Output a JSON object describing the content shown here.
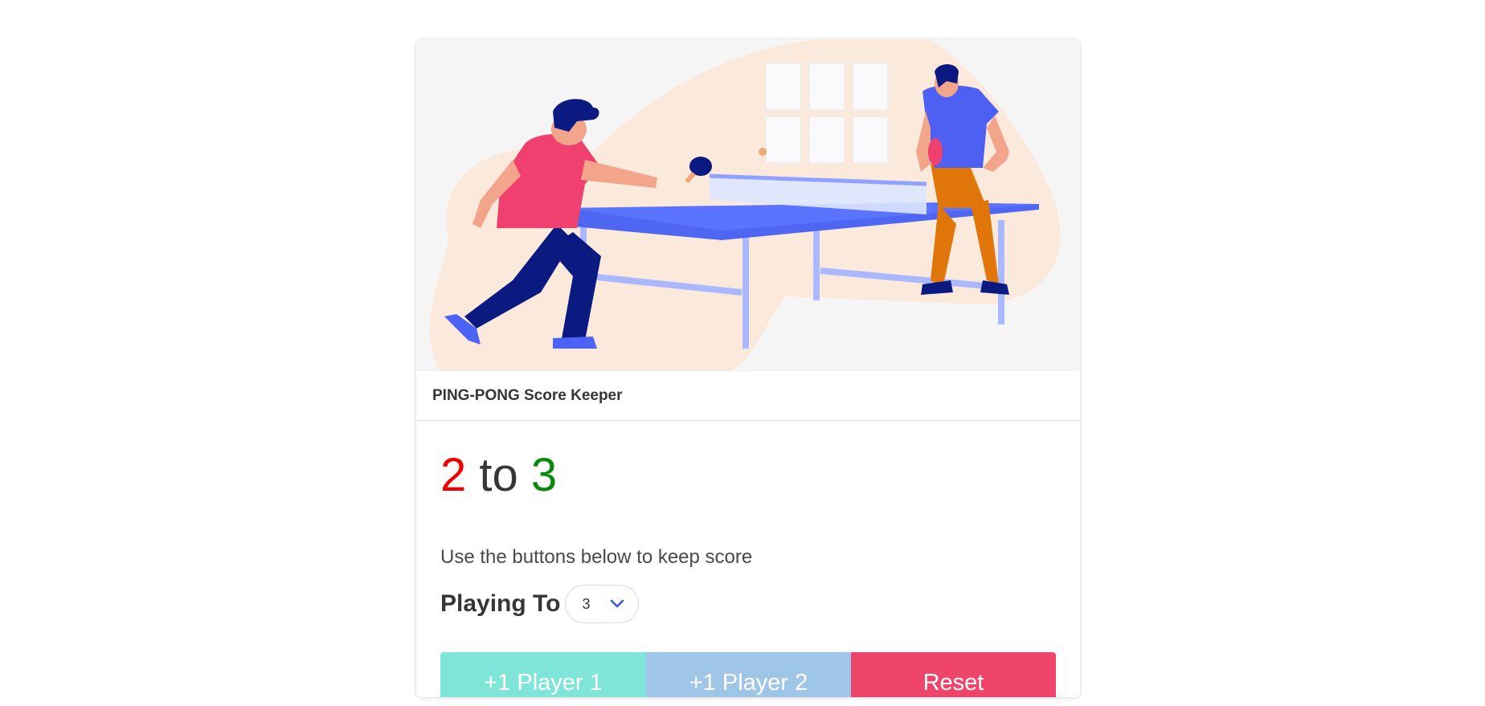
{
  "header": {
    "title": "PING-PONG Score Keeper"
  },
  "score": {
    "player1": "2",
    "separator": "to",
    "player2": "3"
  },
  "subtitle": "Use the buttons below to keep score",
  "playing_to": {
    "label": "Playing To",
    "selected": "3"
  },
  "buttons": {
    "player1": "+1 Player 1",
    "player2": "+1 Player 2",
    "reset": "Reset"
  },
  "colors": {
    "player1_score": "#f00000",
    "player2_score": "#0a8a0a",
    "player1_button": "#7fe5d8",
    "player2_button": "#9fc6e6",
    "reset_button": "#f0456a"
  }
}
